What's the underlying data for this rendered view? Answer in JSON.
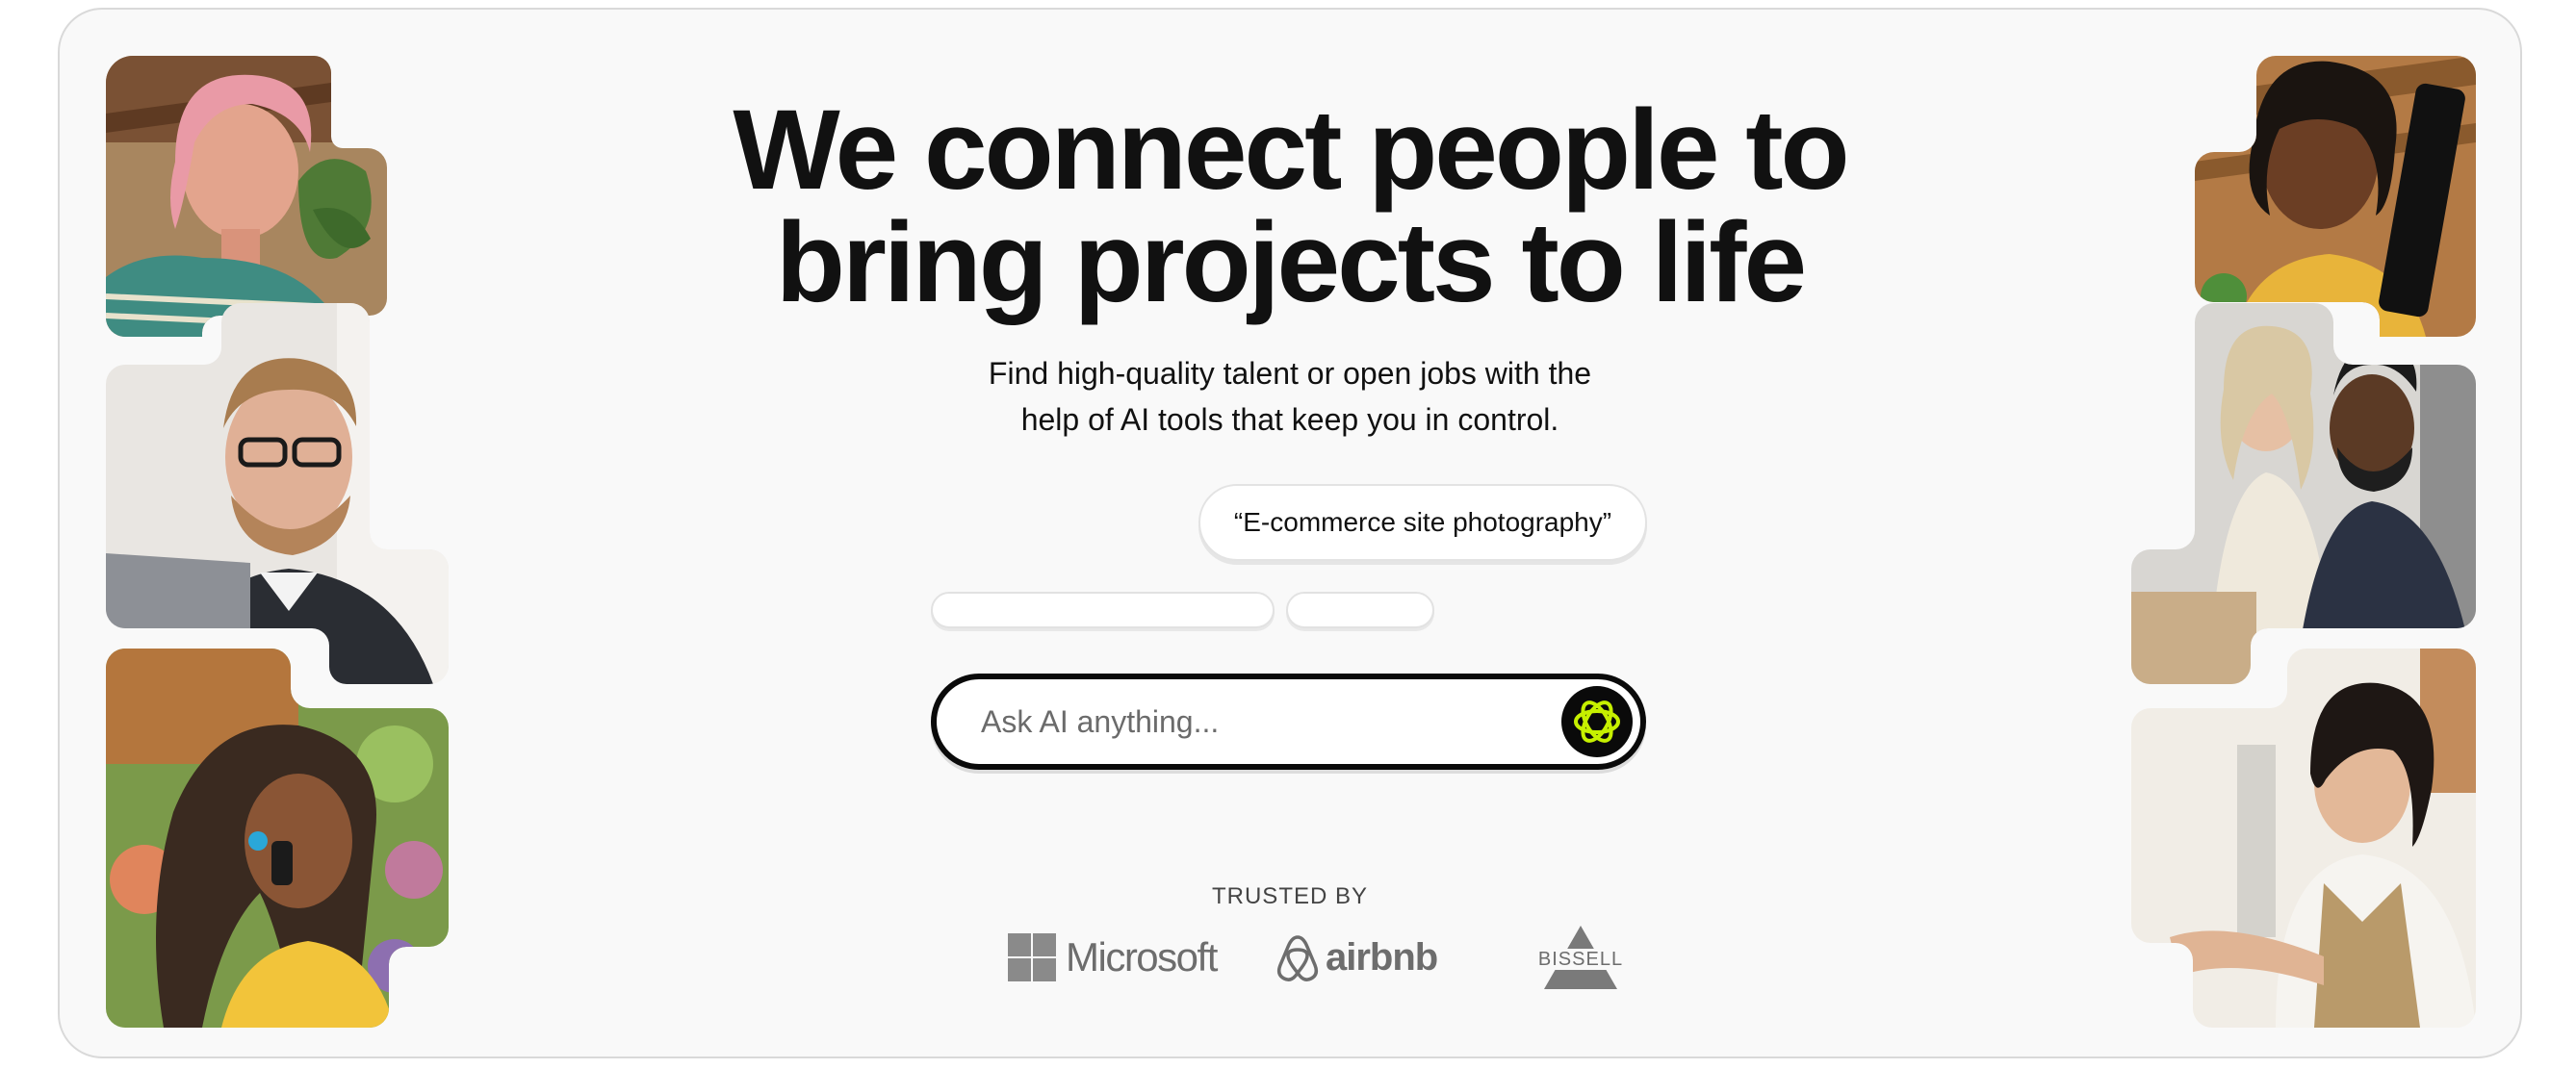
{
  "hero": {
    "headline_line1": "We connect people to",
    "headline_line2": "bring projects to life",
    "subhead_line1": "Find high-quality talent or open jobs with the",
    "subhead_line2": "help of AI tools that keep you in control."
  },
  "chat": {
    "example_prompt": "“E-commerce site photography”"
  },
  "search": {
    "placeholder": "Ask AI anything...",
    "button_icon": "ai-sparkle-icon"
  },
  "trusted": {
    "label": "TRUSTED BY",
    "logos": [
      "Microsoft",
      "airbnb",
      "BISSELL"
    ]
  },
  "photos": {
    "left": [
      "woman-pink-hair-photo",
      "man-glasses-laptop-photo",
      "woman-phone-flowers-photo"
    ],
    "right": [
      "woman-tablet-photo",
      "colleagues-reviewing-photo",
      "woman-working-desk-photo"
    ]
  },
  "colors": {
    "background": "#f9f9f9",
    "text": "#111111",
    "accent": "#c6f000",
    "logo_gray": "#6d6d6d"
  }
}
